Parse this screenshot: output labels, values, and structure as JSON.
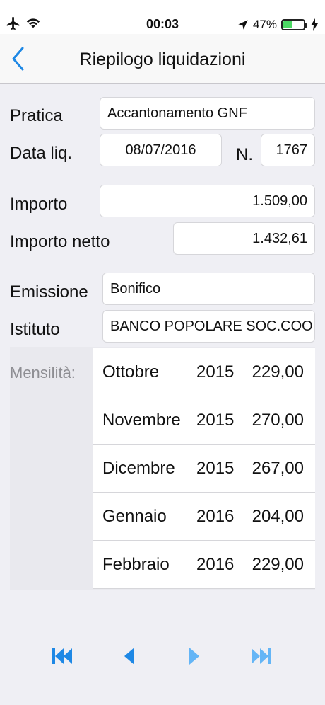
{
  "status_bar": {
    "time": "00:03",
    "battery_percent": "47%",
    "battery_level": 0.47,
    "icons": [
      "airplane-icon",
      "wifi-icon",
      "location-arrow-icon",
      "battery-icon",
      "charging-bolt-icon"
    ]
  },
  "nav": {
    "title": "Riepilogo liquidazioni",
    "back_icon": "chevron-left-icon"
  },
  "form": {
    "pratica_label": "Pratica",
    "pratica_value": "Accantonamento GNF",
    "data_liq_label": "Data liq.",
    "data_liq_value": "08/07/2016",
    "numero_label": "N.",
    "numero_value": "1767",
    "importo_label": "Importo",
    "importo_value": "1.509,00",
    "importo_netto_label": "Importo netto",
    "importo_netto_value": "1.432,61",
    "emissione_label": "Emissione",
    "emissione_value": "Bonifico",
    "istituto_label": "Istituto",
    "istituto_value": "BANCO POPOLARE SOC.COO"
  },
  "mensilita": {
    "label": "Mensilità:",
    "rows": [
      {
        "month": "Ottobre",
        "year": "2015",
        "amount": "229,00"
      },
      {
        "month": "Novembre",
        "year": "2015",
        "amount": "270,00"
      },
      {
        "month": "Dicembre",
        "year": "2015",
        "amount": "267,00"
      },
      {
        "month": "Gennaio",
        "year": "2016",
        "amount": "204,00"
      },
      {
        "month": "Febbraio",
        "year": "2016",
        "amount": "229,00"
      }
    ]
  },
  "pager": {
    "icons": [
      "first-page-icon",
      "previous-icon",
      "next-icon",
      "last-page-icon"
    ]
  },
  "colors": {
    "accent": "#1e88e5",
    "background": "#efeff4"
  }
}
